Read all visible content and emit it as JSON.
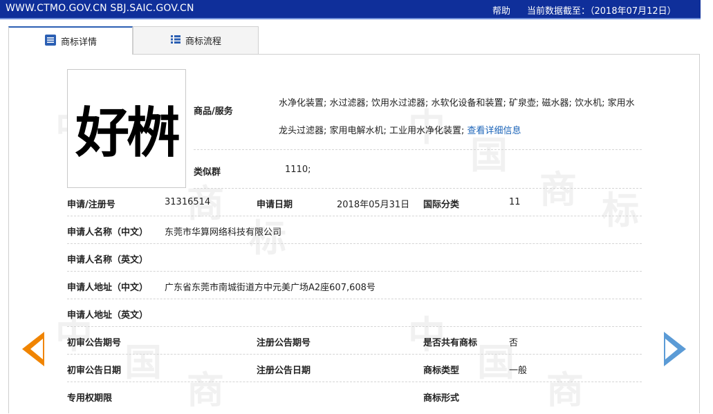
{
  "header": {
    "site": "WWW.CTMO.GOV.CN SBJ.SAIC.GOV.CN",
    "help": "帮助",
    "as_of": "当前数据截至：（2018年07月12日）"
  },
  "tabs": [
    {
      "label": "商标详情",
      "icon": "list-doc-icon"
    },
    {
      "label": "商标流程",
      "icon": "list-bullets-icon"
    }
  ],
  "mark": {
    "image_text": "好桝"
  },
  "watermark": [
    "中",
    "国",
    "商",
    "标"
  ],
  "goods": {
    "label": "商品/服务",
    "text": "水净化装置; 水过滤器; 饮用水过滤器; 水软化设备和装置; 矿泉壶; 磁水器; 饮水机; 家用水龙头过滤器; 家用电解水机; 工业用水净化装置;",
    "link": "查看详细信息"
  },
  "similar_group": {
    "label": "类似群",
    "value": "1110;"
  },
  "reg_no": {
    "label": "申请/注册号",
    "value": "31316514"
  },
  "app_date": {
    "label": "申请日期",
    "value": "2018年05月31日"
  },
  "intl_class": {
    "label": "国际分类",
    "value": "11"
  },
  "applicant_cn": {
    "label": "申请人名称（中文）",
    "value": "东莞市华算网络科技有限公司"
  },
  "applicant_en": {
    "label": "申请人名称（英文）",
    "value": ""
  },
  "address_cn": {
    "label": "申请人地址（中文）",
    "value": "广东省东莞市南城街道方中元美广场A2座607,608号"
  },
  "address_en": {
    "label": "申请人地址（英文）",
    "value": ""
  },
  "prelim_issue": {
    "label": "初审公告期号",
    "value": ""
  },
  "reg_issue": {
    "label": "注册公告期号",
    "value": ""
  },
  "shared": {
    "label": "是否共有商标",
    "value": "否"
  },
  "prelim_date": {
    "label": "初审公告日期",
    "value": ""
  },
  "reg_date": {
    "label": "注册公告日期",
    "value": ""
  },
  "mark_type": {
    "label": "商标类型",
    "value": "一般"
  },
  "exclusive_period": {
    "label": "专用权期限",
    "value": ""
  },
  "mark_form": {
    "label": "商标形式",
    "value": ""
  },
  "colors": {
    "topbar": "#0f2f9a",
    "link": "#1a63b8",
    "prev_arrow": "#f08400",
    "next_arrow": "#5b9bd6"
  }
}
